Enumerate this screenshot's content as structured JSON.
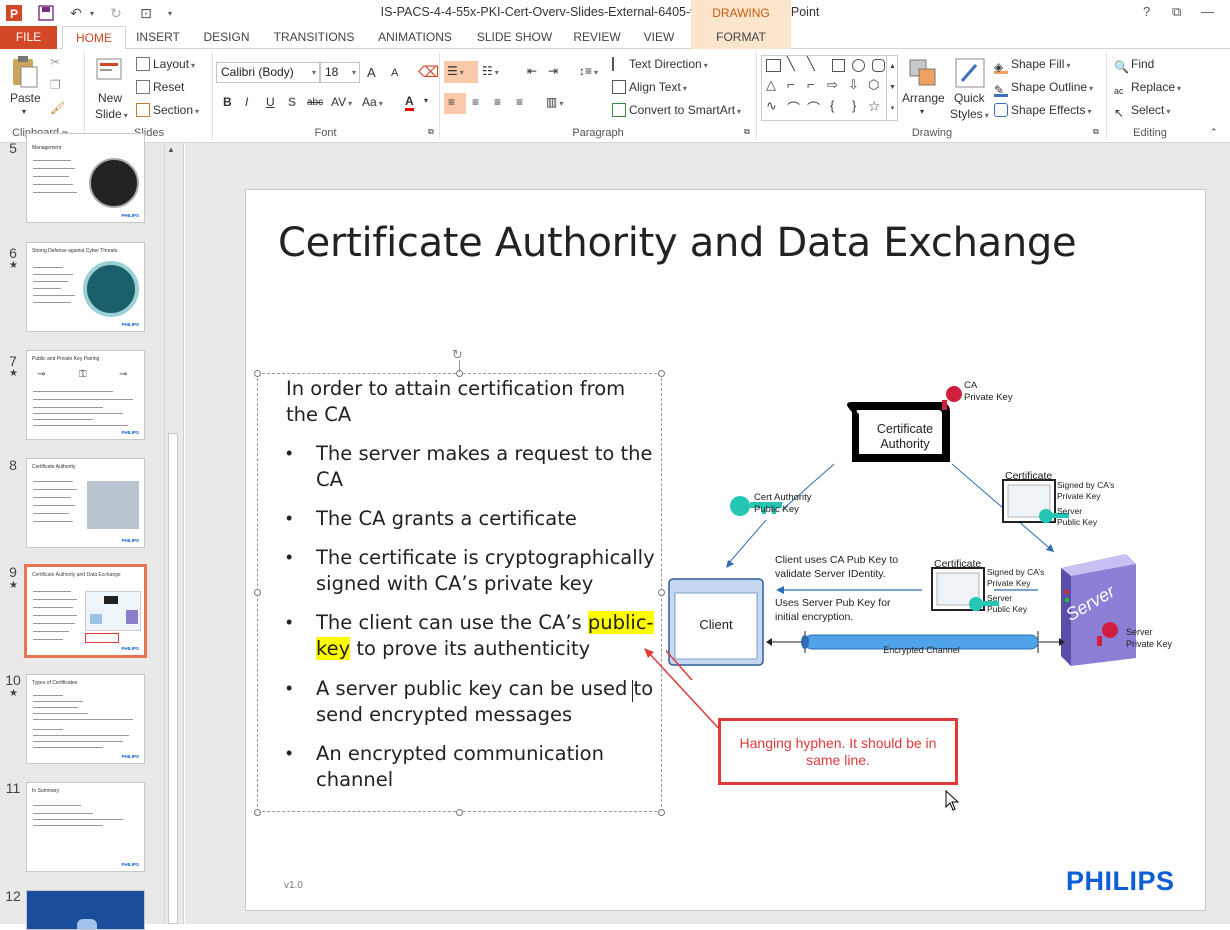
{
  "window": {
    "title": "IS-PACS-4-4-55x-PKI-Cert-Overv-Slides-External-6405-v01-EN-S - PowerPoint",
    "contextual_tab_group": "DRAWING TOOLS",
    "help": "?",
    "minimize": "—",
    "restore": "⧉",
    "close": "✕"
  },
  "tabs": [
    "FILE",
    "HOME",
    "INSERT",
    "DESIGN",
    "TRANSITIONS",
    "ANIMATIONS",
    "SLIDE SHOW",
    "REVIEW",
    "VIEW",
    "FORMAT"
  ],
  "ribbon": {
    "clipboard": {
      "paste": "Paste",
      "label": "Clipboard"
    },
    "slides": {
      "new_slide_1": "New",
      "new_slide_2": "Slide",
      "layout": "Layout",
      "reset": "Reset",
      "section": "Section",
      "label": "Slides"
    },
    "font": {
      "family": "Calibri (Body)",
      "size": "18",
      "grow": "A",
      "shrink": "A",
      "bold": "B",
      "italic": "I",
      "underline": "U",
      "shadow": "S",
      "strike": "abc",
      "spacing": "AV",
      "case": "Aa",
      "color": "A",
      "label": "Font"
    },
    "paragraph": {
      "text_direction": "Text Direction",
      "align_text": "Align Text",
      "convert_smartart": "Convert to SmartArt",
      "label": "Paragraph"
    },
    "drawing": {
      "arrange": "Arrange",
      "quick_1": "Quick",
      "quick_2": "Styles",
      "shape_fill": "Shape Fill",
      "shape_outline": "Shape Outline",
      "shape_effects": "Shape Effects",
      "label": "Drawing"
    },
    "editing": {
      "find": "Find",
      "replace": "Replace",
      "select": "Select",
      "label": "Editing"
    }
  },
  "thumbnails": [
    {
      "num": "5",
      "title": "Management",
      "star": false
    },
    {
      "num": "6",
      "title": "Strong Defense against Cyber Threats",
      "star": true
    },
    {
      "num": "7",
      "title": "Public and Private Key Pairing",
      "star": true
    },
    {
      "num": "8",
      "title": "Certificate Authority",
      "star": false
    },
    {
      "num": "9",
      "title": "Certificate Authority and Data Exchange",
      "star": true
    },
    {
      "num": "10",
      "title": "Types of Certificates",
      "star": true
    },
    {
      "num": "11",
      "title": "In Summary",
      "star": false
    },
    {
      "num": "12",
      "title": "",
      "star": false
    }
  ],
  "thumb_brand": "PHILIPS",
  "slide": {
    "title": "Certificate Authority and Data Exchange",
    "intro_1": "In order to attain certification from",
    "intro_2": "the CA",
    "bullets": [
      [
        "The server makes a request to the",
        "CA"
      ],
      [
        "The CA grants a certificate"
      ],
      [
        "The certificate is cryptographically",
        "signed with CA’s private key"
      ],
      [
        "The client can use the CA’s ",
        "public-",
        "key",
        " to prove its authenticity"
      ],
      [
        "A server public key can be used to",
        "send encrypted messages"
      ],
      [
        "An encrypted communication",
        "channel"
      ]
    ],
    "version": "v1.0",
    "brand": "PHILIPS",
    "callout": "Hanging hyphen. It should be in same line.",
    "diagram": {
      "ca_box_1": "Certificate",
      "ca_box_2": "Authority",
      "ca_private_1": "CA",
      "ca_private_2": "Private Key",
      "cert_authority_1": "Cert Authority",
      "cert_authority_2": "Public Key",
      "certificate": "Certificate",
      "signed_1": "Signed by CA’s",
      "signed_2": "Private Key",
      "server_key_1": "Server",
      "server_key_2": "Public Key",
      "client_uses_1": "Client uses CA Pub Key to",
      "client_uses_2": "validate Server IDentity.",
      "uses_server_1": "Uses Server Pub Key for",
      "uses_server_2": "initial encryption.",
      "client": "Client",
      "server": "Server",
      "server_priv_1": "Server",
      "server_priv_2": "Private Key",
      "channel": "Encrypted Channel"
    }
  }
}
